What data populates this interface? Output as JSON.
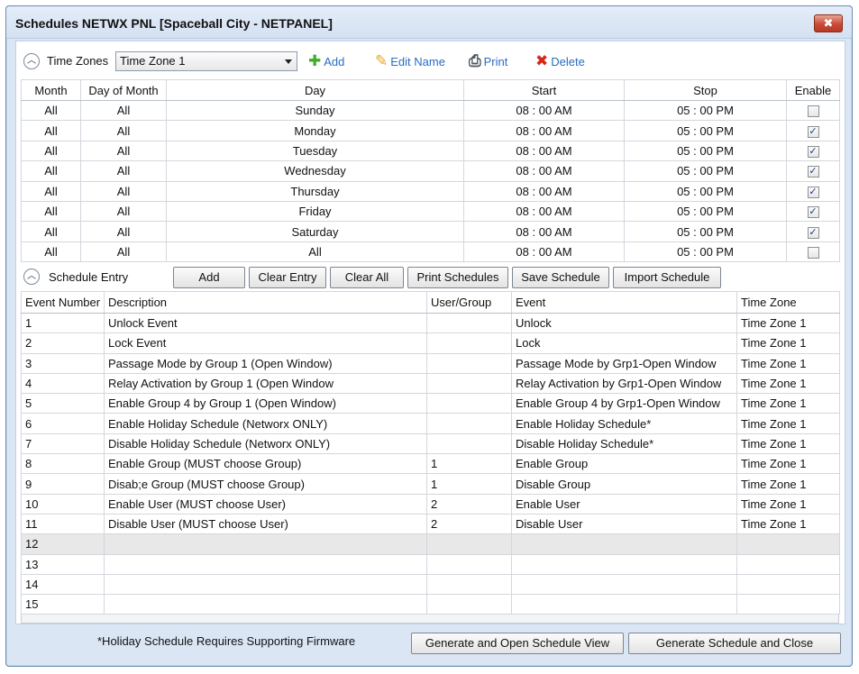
{
  "window": {
    "title": "Schedules NETWX PNL [Spaceball City - NETPANEL]",
    "close_glyph": "✖"
  },
  "toolbar": {
    "time_zones_label": "Time Zones",
    "time_zone_selected": "Time Zone 1",
    "add_label": "Add",
    "edit_name_label": "Edit Name",
    "print_label": "Print",
    "delete_label": "Delete"
  },
  "time_zone_table": {
    "columns": [
      "Month",
      "Day of Month",
      "Day",
      "Start",
      "Stop",
      "Enable"
    ],
    "rows": [
      {
        "month": "All",
        "day_of_month": "All",
        "day": "Sunday",
        "start": "08 : 00 AM",
        "stop": "05 : 00 PM",
        "enabled": false
      },
      {
        "month": "All",
        "day_of_month": "All",
        "day": "Monday",
        "start": "08 : 00 AM",
        "stop": "05 : 00 PM",
        "enabled": true
      },
      {
        "month": "All",
        "day_of_month": "All",
        "day": "Tuesday",
        "start": "08 : 00 AM",
        "stop": "05 : 00 PM",
        "enabled": true
      },
      {
        "month": "All",
        "day_of_month": "All",
        "day": "Wednesday",
        "start": "08 : 00 AM",
        "stop": "05 : 00 PM",
        "enabled": true
      },
      {
        "month": "All",
        "day_of_month": "All",
        "day": "Thursday",
        "start": "08 : 00 AM",
        "stop": "05 : 00 PM",
        "enabled": true
      },
      {
        "month": "All",
        "day_of_month": "All",
        "day": "Friday",
        "start": "08 : 00 AM",
        "stop": "05 : 00 PM",
        "enabled": true
      },
      {
        "month": "All",
        "day_of_month": "All",
        "day": "Saturday",
        "start": "08 : 00 AM",
        "stop": "05 : 00 PM",
        "enabled": true
      },
      {
        "month": "All",
        "day_of_month": "All",
        "day": "All",
        "start": "08 : 00 AM",
        "stop": "05 : 00 PM",
        "enabled": false
      }
    ]
  },
  "schedule_entry": {
    "label": "Schedule Entry",
    "buttons": {
      "add": "Add",
      "clear_entry": "Clear Entry",
      "clear_all": "Clear All",
      "print_schedules": "Print Schedules",
      "save_schedule": "Save Schedule",
      "import_schedule": "Import Schedule"
    }
  },
  "event_table": {
    "columns": [
      "Event Number",
      "Description",
      "User/Group",
      "Event",
      "Time Zone"
    ],
    "rows": [
      {
        "num": "1",
        "desc": "Unlock Event",
        "user_group": "",
        "event": "Unlock",
        "tz": "Time Zone 1"
      },
      {
        "num": "2",
        "desc": "Lock Event",
        "user_group": "",
        "event": "Lock",
        "tz": "Time Zone 1"
      },
      {
        "num": "3",
        "desc": "Passage Mode by Group 1 (Open Window)",
        "user_group": "",
        "event": "Passage Mode by Grp1-Open Window",
        "tz": "Time Zone 1"
      },
      {
        "num": "4",
        "desc": "Relay Activation by Group 1 (Open Window",
        "user_group": "",
        "event": "Relay Activation by Grp1-Open Window",
        "tz": "Time Zone 1"
      },
      {
        "num": "5",
        "desc": "Enable Group 4 by Group 1 (Open Window)",
        "user_group": "",
        "event": "Enable Group 4 by Grp1-Open Window",
        "tz": "Time Zone 1"
      },
      {
        "num": "6",
        "desc": "Enable Holiday Schedule (Networx ONLY)",
        "user_group": "",
        "event": "Enable Holiday Schedule*",
        "tz": "Time Zone 1"
      },
      {
        "num": "7",
        "desc": "Disable Holiday Schedule (Networx ONLY)",
        "user_group": "",
        "event": "Disable Holiday Schedule*",
        "tz": "Time Zone 1"
      },
      {
        "num": "8",
        "desc": "Enable Group (MUST choose Group)",
        "user_group": "1",
        "event": "Enable Group",
        "tz": "Time Zone 1"
      },
      {
        "num": "9",
        "desc": "Disab;e Group (MUST choose Group)",
        "user_group": "1",
        "event": "Disable Group",
        "tz": "Time Zone 1"
      },
      {
        "num": "10",
        "desc": "Enable User (MUST choose User)",
        "user_group": "2",
        "event": "Enable User",
        "tz": "Time Zone 1"
      },
      {
        "num": "11",
        "desc": "Disable User (MUST choose User)",
        "user_group": "2",
        "event": "Disable User",
        "tz": "Time Zone 1"
      },
      {
        "num": "12",
        "desc": "",
        "user_group": "",
        "event": "",
        "tz": "",
        "selected": true
      },
      {
        "num": "13",
        "desc": "",
        "user_group": "",
        "event": "",
        "tz": ""
      },
      {
        "num": "14",
        "desc": "",
        "user_group": "",
        "event": "",
        "tz": ""
      },
      {
        "num": "15",
        "desc": "",
        "user_group": "",
        "event": "",
        "tz": ""
      }
    ]
  },
  "footer": {
    "note": "*Holiday Schedule Requires Supporting Firmware",
    "generate_open_label": "Generate and Open Schedule View",
    "generate_close_label": "Generate Schedule and Close"
  },
  "icons": {
    "add": "plus-icon",
    "edit": "pencil-icon",
    "print": "printer-icon",
    "delete": "x-icon",
    "collapse": "chevron-up-icon"
  },
  "colors": {
    "link_blue": "#2a6cc4",
    "add_green": "#3fae2a",
    "delete_red": "#d62716",
    "window_frame": "#dbe6f4",
    "close_red": "#c94a34"
  }
}
